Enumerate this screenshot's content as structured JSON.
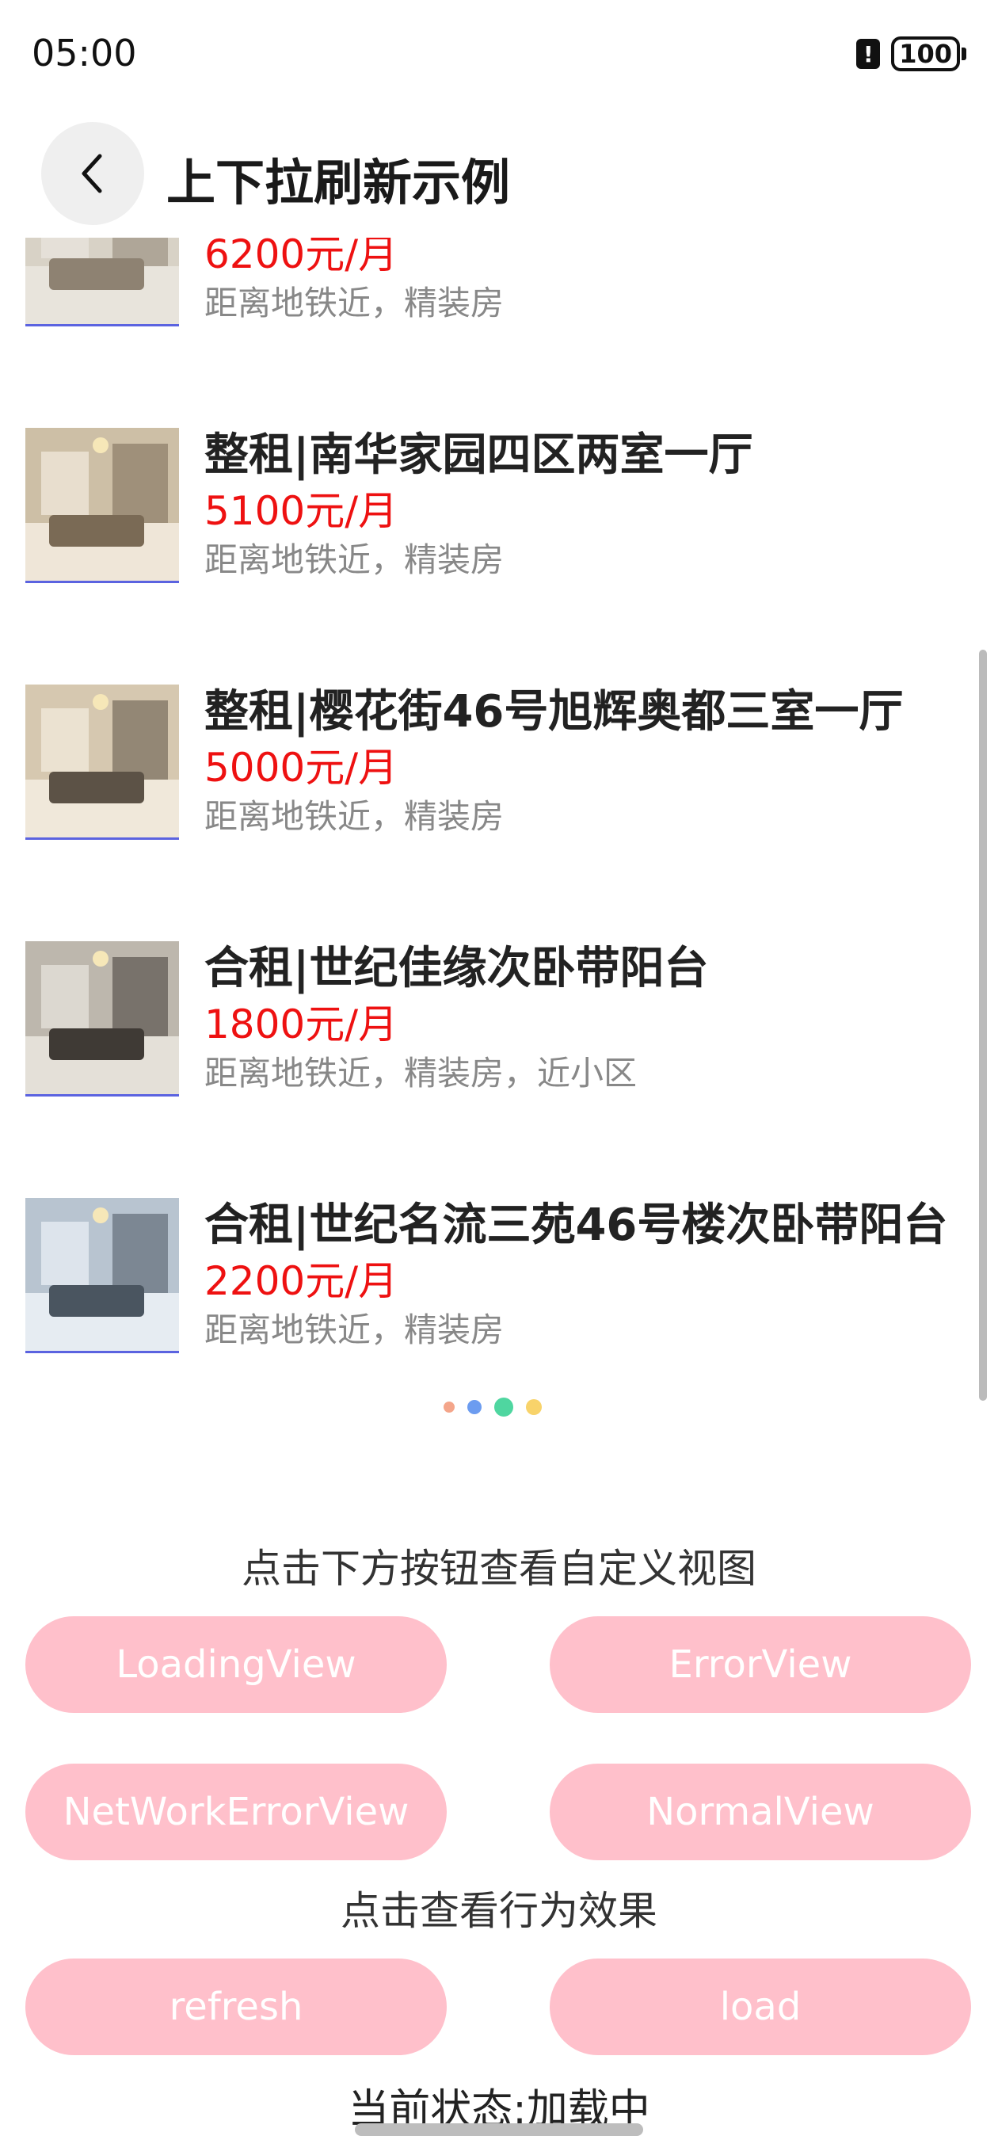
{
  "status_bar": {
    "time": "05:00",
    "alert_glyph": "!",
    "battery": "100"
  },
  "header": {
    "title": "上下拉刷新示例",
    "back_icon": "chevron-left-icon"
  },
  "listings": [
    {
      "title": "",
      "price": "6200元/月",
      "desc": "距离地铁近，精装房",
      "thumb_colors": [
        "#d8d2c6",
        "#8e8272",
        "#e8e4dc"
      ]
    },
    {
      "title": "整租|南华家园四区两室一厅",
      "price": "5100元/月",
      "desc": "距离地铁近，精装房",
      "thumb_colors": [
        "#cdbfa6",
        "#7a6a55",
        "#efe6d8"
      ]
    },
    {
      "title": "整租|樱花街46号旭辉奥都三室一厅",
      "price": "5000元/月",
      "desc": "距离地铁近，精装房",
      "thumb_colors": [
        "#d6c8b0",
        "#5c5246",
        "#f0e8da"
      ]
    },
    {
      "title": "合租|世纪佳缘次卧带阳台",
      "price": "1800元/月",
      "desc": "距离地铁近，精装房，近小区",
      "thumb_colors": [
        "#bdb7ad",
        "#3f3a35",
        "#e4e0d8"
      ]
    },
    {
      "title": "合租|世纪名流三苑46号楼次卧带阳台",
      "price": "2200元/月",
      "desc": "距离地铁近，精装房",
      "thumb_colors": [
        "#b8c4d0",
        "#4a5560",
        "#e6ecf2"
      ]
    }
  ],
  "loading_dots": [
    "#f4a58a",
    "#6c9cf0",
    "#4fd6a0",
    "#f8d36a"
  ],
  "custom_view": {
    "label": "点击下方按钮查看自定义视图",
    "buttons": [
      "LoadingView",
      "ErrorView",
      "NetWorkErrorView",
      "NormalView"
    ]
  },
  "behavior": {
    "label": "点击查看行为效果",
    "buttons": [
      "refresh",
      "load"
    ]
  },
  "current_status": "当前状态:加载中",
  "colors": {
    "button_bg": "#ffc0cb",
    "price": "#ee1111",
    "thumb_border": "#5b63e0"
  }
}
